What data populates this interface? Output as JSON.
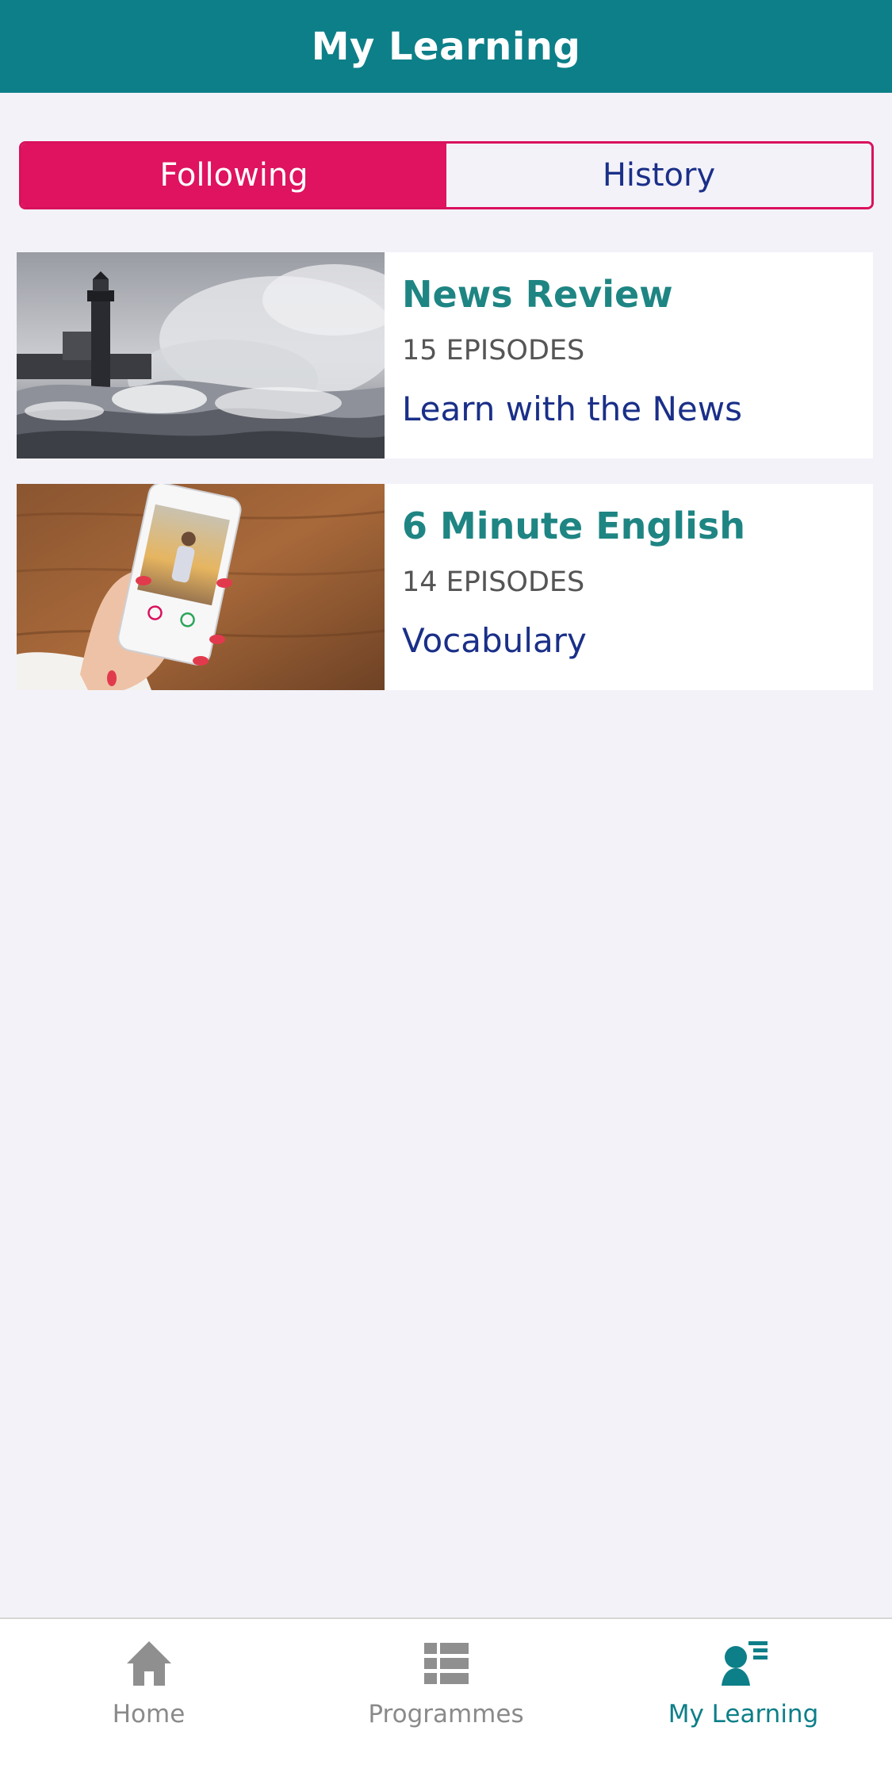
{
  "header": {
    "title": "My Learning"
  },
  "segments": {
    "following": "Following",
    "history": "History",
    "selected": "Following"
  },
  "programmes": [
    {
      "title": "News Review",
      "episodes": "15 EPISODES",
      "tag": "Learn with the News",
      "image": "lighthouse-storm-photo"
    },
    {
      "title": "6 Minute English",
      "episodes": "14 EPISODES",
      "tag": "Vocabulary",
      "image": "hand-holding-phone-photo"
    }
  ],
  "tabbar": {
    "items": [
      {
        "label": "Home",
        "icon": "home-icon",
        "active": false
      },
      {
        "label": "Programmes",
        "icon": "list-grid-icon",
        "active": false
      },
      {
        "label": "My Learning",
        "icon": "person-list-icon",
        "active": true
      }
    ]
  },
  "colors": {
    "header": "#0d7f88",
    "accent": "#df135f",
    "title": "#1e8583",
    "link": "#1a2f88",
    "background": "#f3f2f9"
  }
}
